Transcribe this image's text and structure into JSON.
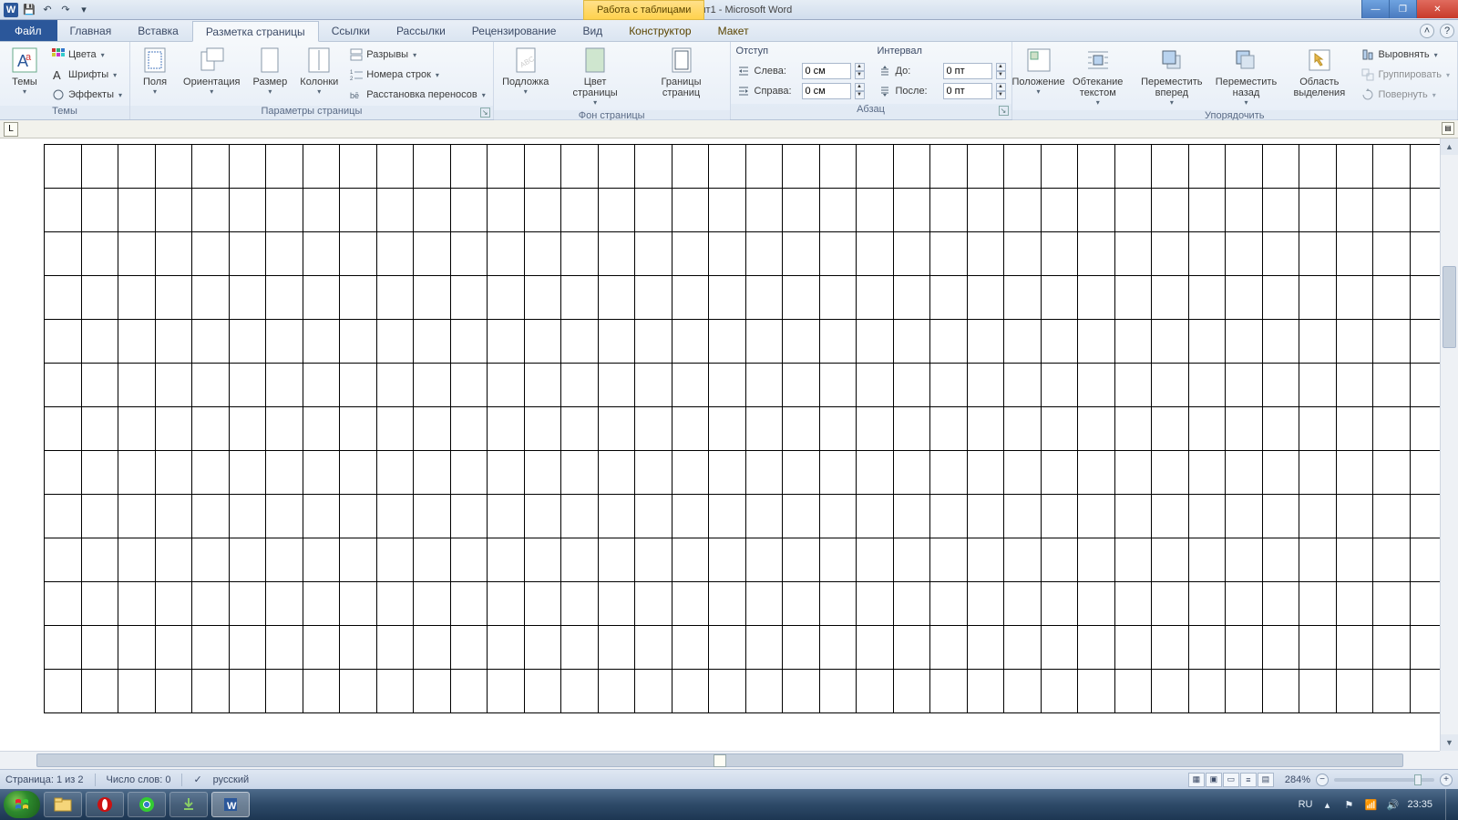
{
  "titlebar": {
    "doc_title": "Документ1 - Microsoft Word",
    "context_tab": "Работа с таблицами"
  },
  "tabs": {
    "file": "Файл",
    "items": [
      "Главная",
      "Вставка",
      "Разметка страницы",
      "Ссылки",
      "Рассылки",
      "Рецензирование",
      "Вид",
      "Конструктор",
      "Макет"
    ],
    "active_index": 2
  },
  "ribbon": {
    "themes": {
      "label": "Темы",
      "btn": "Темы",
      "colors": "Цвета",
      "fonts": "Шрифты",
      "effects": "Эффекты"
    },
    "page_setup": {
      "label": "Параметры страницы",
      "margins": "Поля",
      "orientation": "Ориентация",
      "size": "Размер",
      "columns": "Колонки",
      "breaks": "Разрывы",
      "line_numbers": "Номера строк",
      "hyphenation": "Расстановка переносов"
    },
    "page_bg": {
      "label": "Фон страницы",
      "watermark": "Подложка",
      "page_color": "Цвет страницы",
      "borders": "Границы страниц"
    },
    "paragraph": {
      "label": "Абзац",
      "indent_title": "Отступ",
      "indent_left_label": "Слева:",
      "indent_left_value": "0 см",
      "indent_right_label": "Справа:",
      "indent_right_value": "0 см",
      "spacing_title": "Интервал",
      "spacing_before_label": "До:",
      "spacing_before_value": "0 пт",
      "spacing_after_label": "После:",
      "spacing_after_value": "0 пт"
    },
    "arrange": {
      "label": "Упорядочить",
      "position": "Положение",
      "wrap": "Обтекание текстом",
      "forward": "Переместить вперед",
      "backward": "Переместить назад",
      "selection_pane": "Область выделения",
      "align": "Выровнять",
      "group": "Группировать",
      "rotate": "Повернуть"
    }
  },
  "ruler": {
    "tab_type": "L"
  },
  "table": {
    "rows": 13,
    "cols": 38
  },
  "statusbar": {
    "page": "Страница: 1 из 2",
    "words": "Число слов: 0",
    "language": "русский",
    "zoom": "284%"
  },
  "taskbar": {
    "lang": "RU",
    "time": "23:35"
  }
}
